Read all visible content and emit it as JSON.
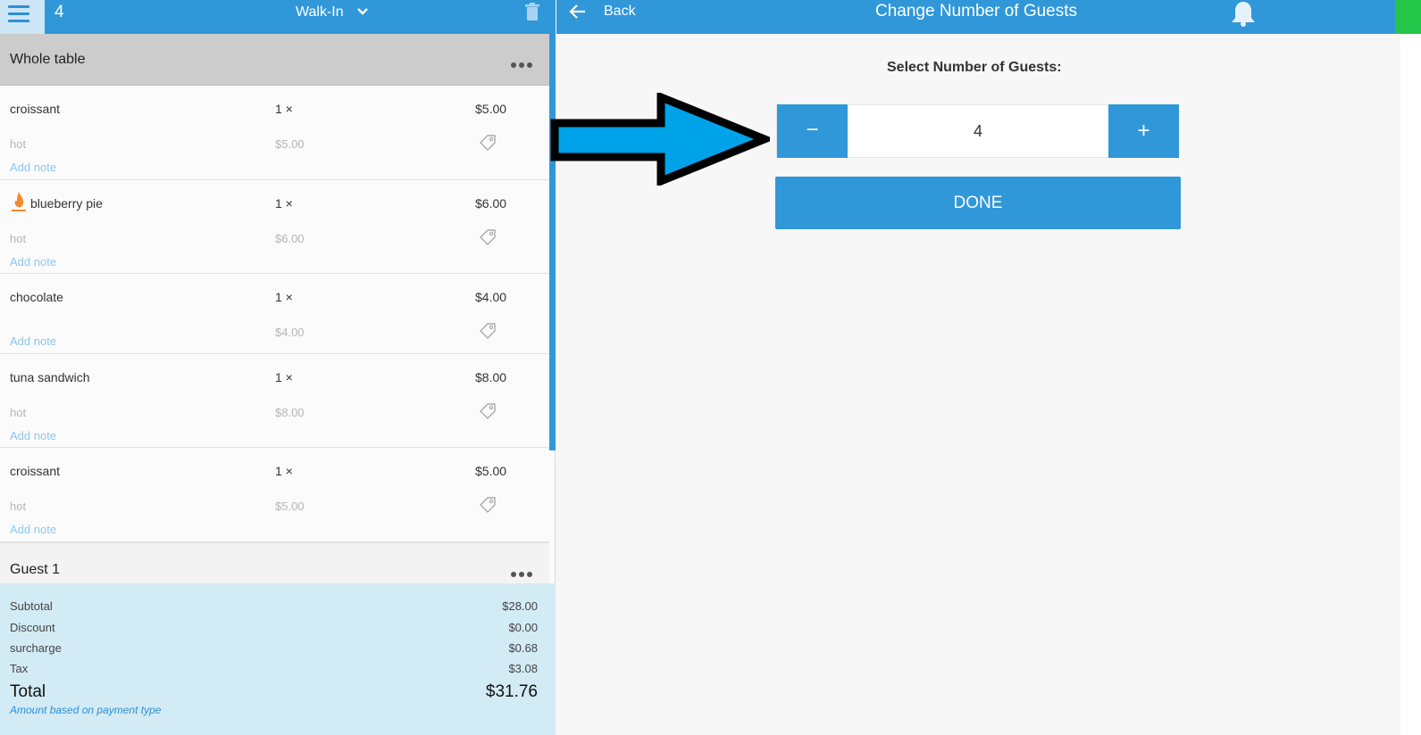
{
  "header": {
    "table_number": "4",
    "order_type": "Walk-In"
  },
  "ticket": {
    "section_label": "Whole table",
    "items": [
      {
        "name": "croissant",
        "qty": "1 ×",
        "price": "$5.00",
        "modifier": "hot",
        "modifier_price": "$5.00",
        "note": "Add note",
        "icon": ""
      },
      {
        "name": "blueberry pie",
        "qty": "1 ×",
        "price": "$6.00",
        "modifier": "hot",
        "modifier_price": "$6.00",
        "note": "Add note",
        "icon": "flame-icon"
      },
      {
        "name": "chocolate",
        "qty": "1 ×",
        "price": "$4.00",
        "modifier": "",
        "modifier_price": "$4.00",
        "note": "Add note",
        "icon": ""
      },
      {
        "name": "tuna sandwich",
        "qty": "1 ×",
        "price": "$8.00",
        "modifier": "hot",
        "modifier_price": "$8.00",
        "note": "Add note",
        "icon": ""
      },
      {
        "name": "croissant",
        "qty": "1 ×",
        "price": "$5.00",
        "modifier": "hot",
        "modifier_price": "$5.00",
        "note": "Add note",
        "icon": ""
      }
    ],
    "guest_label": "Guest 1"
  },
  "totals": {
    "subtotal_label": "Subtotal",
    "subtotal": "$28.00",
    "discount_label": "Discount",
    "discount": "$0.00",
    "surcharge_label": "surcharge",
    "surcharge": "$0.68",
    "tax_label": "Tax",
    "tax": "$3.08",
    "total_label": "Total",
    "total": "$31.76",
    "note": "Amount based on payment type"
  },
  "dialog": {
    "back_label": "Back",
    "title": "Change Number of Guests",
    "select_label": "Select Number of Guests:",
    "minus_label": "−",
    "value": "4",
    "plus_label": "+",
    "done_label": "DONE"
  },
  "colors": {
    "primary": "#3097d9",
    "totals_bg": "#d3ebf5",
    "accent_green": "#24c64a",
    "arrow": "#00a2e8"
  }
}
